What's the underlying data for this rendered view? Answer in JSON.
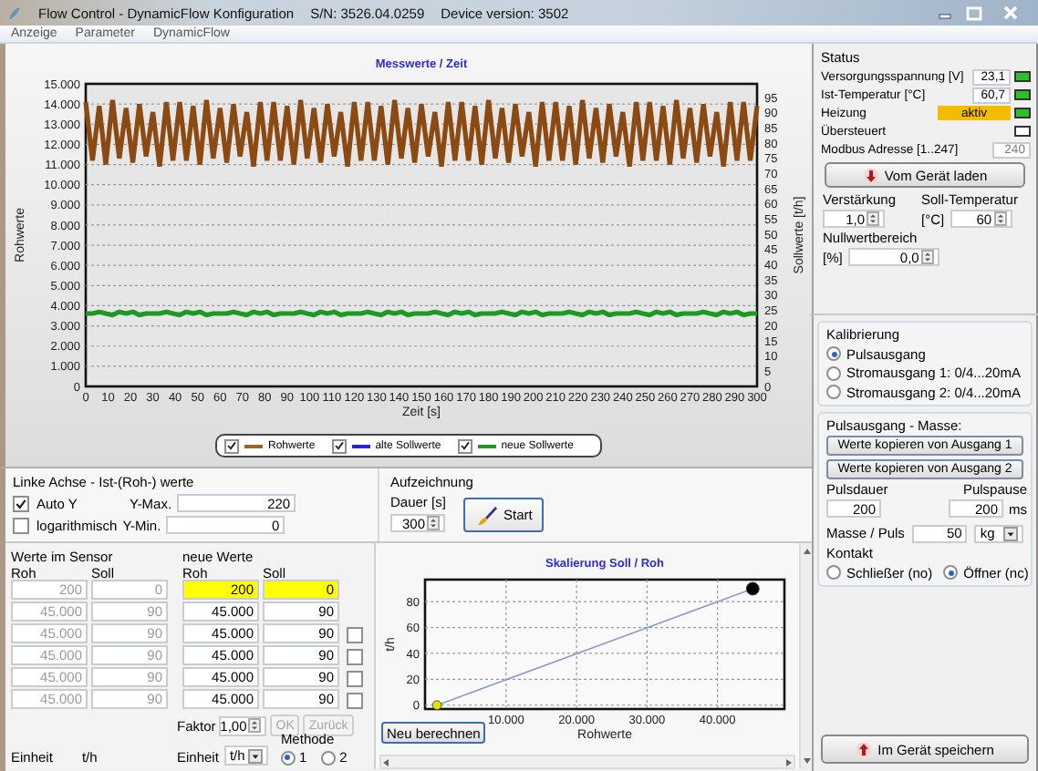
{
  "window": {
    "title": "Flow Control - DynamicFlow Konfiguration",
    "serial": "S/N: 3526.04.0259",
    "version": "Device version: 3502"
  },
  "menu": [
    "Anzeige",
    "Parameter",
    "DynamicFlow"
  ],
  "main_chart": {
    "chart_data": {
      "type": "line",
      "title": "Messwerte / Zeit",
      "xlabel": "Zeit [s]",
      "ylabel": "Rohwerte",
      "y2label": "Sollwerte [t/h]",
      "x": [
        0,
        3,
        6,
        9,
        12,
        15,
        18,
        21,
        24,
        27,
        30,
        33,
        36,
        39,
        42,
        45,
        48,
        51,
        54,
        57,
        60,
        63,
        66,
        69,
        72,
        75,
        78,
        81,
        84,
        87,
        90,
        93,
        96,
        99,
        102,
        105,
        108,
        111,
        114,
        117,
        120,
        123,
        126,
        129,
        132,
        135,
        138,
        141,
        144,
        147,
        150,
        153,
        156,
        159,
        162,
        165,
        168,
        171,
        174,
        177,
        180,
        183,
        186,
        189,
        192,
        195,
        198,
        201,
        204,
        207,
        210,
        213,
        216,
        219,
        222,
        225,
        228,
        231,
        234,
        237,
        240,
        243,
        246,
        249,
        252,
        255,
        258,
        261,
        264,
        267,
        270,
        273,
        276,
        279,
        282,
        285,
        288,
        291,
        294,
        297,
        300
      ],
      "series": [
        {
          "color": "#8b4a12",
          "values": [
            14100,
            11200,
            13900,
            11000,
            14200,
            11300,
            13800,
            11100,
            14000,
            11400,
            13600,
            10900,
            14100,
            11200,
            14100,
            11200,
            13900,
            11000,
            14200,
            11300,
            13800,
            11100,
            14000,
            11400,
            13600,
            10900,
            14100,
            11200,
            14100,
            11200,
            13900,
            11000,
            14200,
            11300,
            13800,
            11100,
            14000,
            11400,
            13600,
            10900,
            14100,
            11200,
            14100,
            11200,
            13900,
            11000,
            14200,
            11300,
            13800,
            11100,
            14000,
            11400,
            13600,
            10900,
            14100,
            11200,
            14100,
            11200,
            13900,
            11000,
            14200,
            11300,
            13800,
            11100,
            14000,
            11400,
            13600,
            10900,
            14100,
            11200,
            14100,
            11200,
            13900,
            11000,
            14200,
            11300,
            13800,
            11100,
            14000,
            11400,
            13600,
            10900,
            14100,
            11200,
            14100,
            11200,
            13900,
            11000,
            14200,
            11300,
            13800,
            11100,
            14000,
            11400,
            13600,
            10900,
            14100,
            11200,
            14100,
            11200,
            13900
          ]
        },
        {
          "color": "#1c9a22",
          "axis": "y2",
          "values": [
            24,
            24,
            24.5,
            24,
            23.5,
            24.5,
            24,
            24.5,
            23.5,
            24,
            24,
            24,
            24.5,
            24,
            23.5,
            24.5,
            24,
            24.5,
            23.5,
            24,
            24,
            24,
            24.5,
            24,
            23.5,
            24.5,
            24,
            24.5,
            23.5,
            24,
            24,
            24,
            24.5,
            24,
            23.5,
            24.5,
            24,
            24.5,
            23.5,
            24,
            24,
            24,
            24.5,
            24,
            23.5,
            24.5,
            24,
            24.5,
            23.5,
            24,
            24,
            24,
            24.5,
            24,
            23.5,
            24.5,
            24,
            24.5,
            23.5,
            24,
            24,
            24,
            24.5,
            24,
            23.5,
            24.5,
            24,
            24.5,
            23.5,
            24,
            24,
            24,
            24.5,
            24,
            23.5,
            24.5,
            24,
            24.5,
            23.5,
            24,
            24,
            24,
            24.5,
            24,
            23.5,
            24.5,
            24,
            24.5,
            23.5,
            24,
            24,
            24,
            24.5,
            24,
            23.5,
            24.5,
            24,
            24.5,
            23.5,
            24,
            24
          ]
        }
      ],
      "xlim": [
        0,
        300
      ],
      "ylim": [
        0,
        15000
      ],
      "y2lim": [
        0,
        99.5
      ],
      "grid": true,
      "xticks": [
        0,
        10,
        20,
        30,
        40,
        50,
        60,
        70,
        80,
        90,
        100,
        110,
        120,
        130,
        140,
        150,
        160,
        170,
        180,
        190,
        200,
        210,
        220,
        230,
        240,
        250,
        260,
        270,
        280,
        290,
        300
      ],
      "yticks": [
        {
          "value": 0,
          "label": "0"
        },
        {
          "value": 1000,
          "label": "1.000"
        },
        {
          "value": 2000,
          "label": "2.000"
        },
        {
          "value": 3000,
          "label": "3.000"
        },
        {
          "value": 4000,
          "label": "4.000"
        },
        {
          "value": 5000,
          "label": "5.000"
        },
        {
          "value": 6000,
          "label": "6.000"
        },
        {
          "value": 7000,
          "label": "7.000"
        },
        {
          "value": 8000,
          "label": "8.000"
        },
        {
          "value": 9000,
          "label": "9.000"
        },
        {
          "value": 10000,
          "label": "10.000"
        },
        {
          "value": 11000,
          "label": "11.000"
        },
        {
          "value": 12000,
          "label": "12.000"
        },
        {
          "value": 13000,
          "label": "13.000"
        },
        {
          "value": 14000,
          "label": "14.000"
        },
        {
          "value": 15000,
          "label": "15.000"
        }
      ],
      "y2ticks": [
        0,
        5,
        10,
        15,
        20,
        25,
        30,
        35,
        40,
        45,
        50,
        55,
        60,
        65,
        70,
        75,
        80,
        85,
        90,
        95
      ]
    },
    "legend": [
      {
        "label": "Rohwerte",
        "checked": true,
        "color": "#a0642a"
      },
      {
        "label": "alte Sollwerte",
        "checked": true,
        "color": "#2424e0"
      },
      {
        "label": "neue Sollwerte",
        "checked": true,
        "color": "#1c9a22"
      }
    ]
  },
  "left_axis": {
    "title": "Linke Achse - Ist-(Roh-) werte",
    "auto_y": {
      "label": "Auto Y",
      "checked": true
    },
    "logarithmic": {
      "label": "logarithmisch",
      "checked": false
    },
    "y_max": {
      "label": "Y-Max.",
      "value": "220"
    },
    "y_min": {
      "label": "Y-Min.",
      "value": "0"
    }
  },
  "recording": {
    "title": "Aufzeichnung",
    "duration_label": "Dauer [s]",
    "duration": "300",
    "start_button": "Start"
  },
  "sensor_values": {
    "title": "Werte im Sensor",
    "disabled": true,
    "columns": [
      "Roh",
      "Soll"
    ],
    "rows": [
      [
        "200",
        "0"
      ],
      [
        "45.000",
        "90"
      ],
      [
        "45.000",
        "90"
      ],
      [
        "45.000",
        "90"
      ],
      [
        "45.000",
        "90"
      ],
      [
        "45.000",
        "90"
      ]
    ],
    "unit_label": "Einheit",
    "unit": "t/h"
  },
  "new_values": {
    "title": "neue Werte",
    "columns": [
      "Roh",
      "Soll"
    ],
    "rows": [
      {
        "roh": "200",
        "soll": "0",
        "selected": true
      },
      {
        "roh": "45.000",
        "soll": "90",
        "selected": false
      },
      {
        "roh": "45.000",
        "soll": "90",
        "selected": false,
        "checked": false
      },
      {
        "roh": "45.000",
        "soll": "90",
        "selected": false,
        "checked": false
      },
      {
        "roh": "45.000",
        "soll": "90",
        "selected": false,
        "checked": false
      },
      {
        "roh": "45.000",
        "soll": "90",
        "selected": false,
        "checked": false
      }
    ],
    "factor_label": "Faktor",
    "factor": "1,00",
    "buttons": [
      {
        "label": "OK",
        "disabled": true
      },
      {
        "label": "Zurück",
        "disabled": true
      }
    ],
    "unit_label": "Einheit",
    "unit": "t/h",
    "method": {
      "label": "Methode",
      "options": [
        {
          "label": "1",
          "selected": true
        },
        {
          "label": "2",
          "selected": false
        }
      ]
    }
  },
  "scale_chart": {
    "chart_data": {
      "type": "line",
      "title": "Skalierung Soll / Roh",
      "xlabel": "Rohwerte",
      "ylabel": "t/h",
      "x": [
        200,
        45000
      ],
      "series": [
        {
          "color": "#8a9ccc",
          "marker": true,
          "values": [
            0,
            90
          ]
        }
      ],
      "xlim": [
        -1500,
        49500
      ],
      "ylim": [
        -3,
        97
      ],
      "grid": true,
      "xticks": [
        {
          "value": 10000,
          "label": "10.000"
        },
        {
          "value": 20000,
          "label": "20.000"
        },
        {
          "value": 30000,
          "label": "30.000"
        },
        {
          "value": 40000,
          "label": "40.000"
        }
      ],
      "yticks": [
        0,
        20,
        40,
        60,
        80
      ]
    },
    "button": "Neu berechnen"
  },
  "status": {
    "title": "Status",
    "rows": [
      {
        "kind": "reading",
        "label": "Versorgungsspannung [V]",
        "value": "23,1",
        "on": true
      },
      {
        "kind": "reading",
        "label": "Ist-Temperatur [°C]",
        "value": "60,7",
        "on": true
      },
      {
        "kind": "badge",
        "label": "Heizung",
        "value": "aktiv",
        "on": true
      },
      {
        "kind": "indicator",
        "label": "Übersteuert",
        "on": false
      },
      {
        "kind": "field",
        "label": "Modbus Adresse [1..247]",
        "value": "240",
        "disabled": true
      }
    ],
    "load_button": "Vom Gerät laden",
    "gain": {
      "label": "Verstärkung",
      "value": "1,0"
    },
    "target_temp": {
      "label": "Soll-Temperatur",
      "unit": "[°C]",
      "value": "60"
    },
    "zero_range": {
      "label": "Nullwertbereich",
      "unit": "[%]",
      "value": "0,0"
    }
  },
  "calibration": {
    "title": "Kalibrierung",
    "options": [
      {
        "label": "Pulsausgang",
        "selected": true
      },
      {
        "label": "Stromausgang 1: 0/4...20mA",
        "selected": false
      },
      {
        "label": "Stromausgang 2: 0/4...20mA",
        "selected": false
      }
    ]
  },
  "pulse_output": {
    "title": "Pulsausgang - Masse:",
    "copy_buttons": [
      "Werte kopieren von Ausgang 1",
      "Werte kopieren von Ausgang 2"
    ],
    "pulse_duration": {
      "label": "Pulsdauer",
      "value": "200"
    },
    "pulse_pause": {
      "label": "Pulspause",
      "value": "200",
      "unit": "ms"
    },
    "mass_per_pulse": {
      "label": "Masse / Puls",
      "value": "50",
      "unit": "kg"
    },
    "contact": {
      "label": "Kontakt",
      "options": [
        {
          "label": "Schließer (no)",
          "selected": false
        },
        {
          "label": "Öffner (nc)",
          "selected": true
        }
      ]
    }
  },
  "save_button": "Im Gerät speichern"
}
